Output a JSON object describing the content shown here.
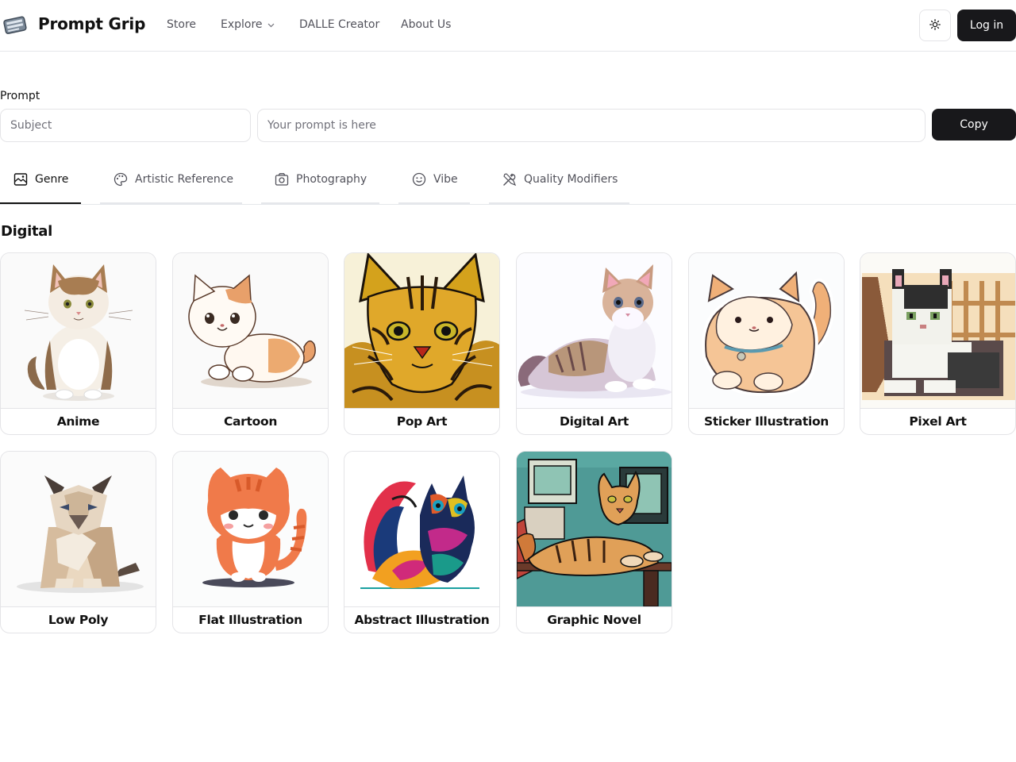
{
  "header": {
    "brand": "Prompt Grip",
    "nav": [
      {
        "label": "Store"
      },
      {
        "label": "Explore"
      },
      {
        "label": "DALLE Creator"
      },
      {
        "label": "About Us"
      }
    ],
    "login_label": "Log in"
  },
  "prompt": {
    "label": "Prompt",
    "subject_placeholder": "Subject",
    "prompt_placeholder": "Your prompt is here",
    "copy_label": "Copy"
  },
  "tabs": [
    {
      "label": "Genre",
      "icon": "genre-icon",
      "active": true
    },
    {
      "label": "Artistic Reference",
      "icon": "palette-icon",
      "active": false
    },
    {
      "label": "Photography",
      "icon": "camera-icon",
      "active": false
    },
    {
      "label": "Vibe",
      "icon": "smiley-icon",
      "active": false
    },
    {
      "label": "Quality Modifiers",
      "icon": "tools-icon",
      "active": false
    }
  ],
  "section": {
    "title": "Digital",
    "cards": [
      {
        "label": "Anime"
      },
      {
        "label": "Cartoon"
      },
      {
        "label": "Pop Art"
      },
      {
        "label": "Digital Art"
      },
      {
        "label": "Sticker Illustration"
      },
      {
        "label": "Pixel Art"
      },
      {
        "label": "Low Poly"
      },
      {
        "label": "Flat Illustration"
      },
      {
        "label": "Abstract Illustration"
      },
      {
        "label": "Graphic Novel"
      }
    ]
  },
  "colors": {
    "primary_button": "#18181b",
    "border": "#e4e4e7",
    "muted_text": "#52525b"
  }
}
